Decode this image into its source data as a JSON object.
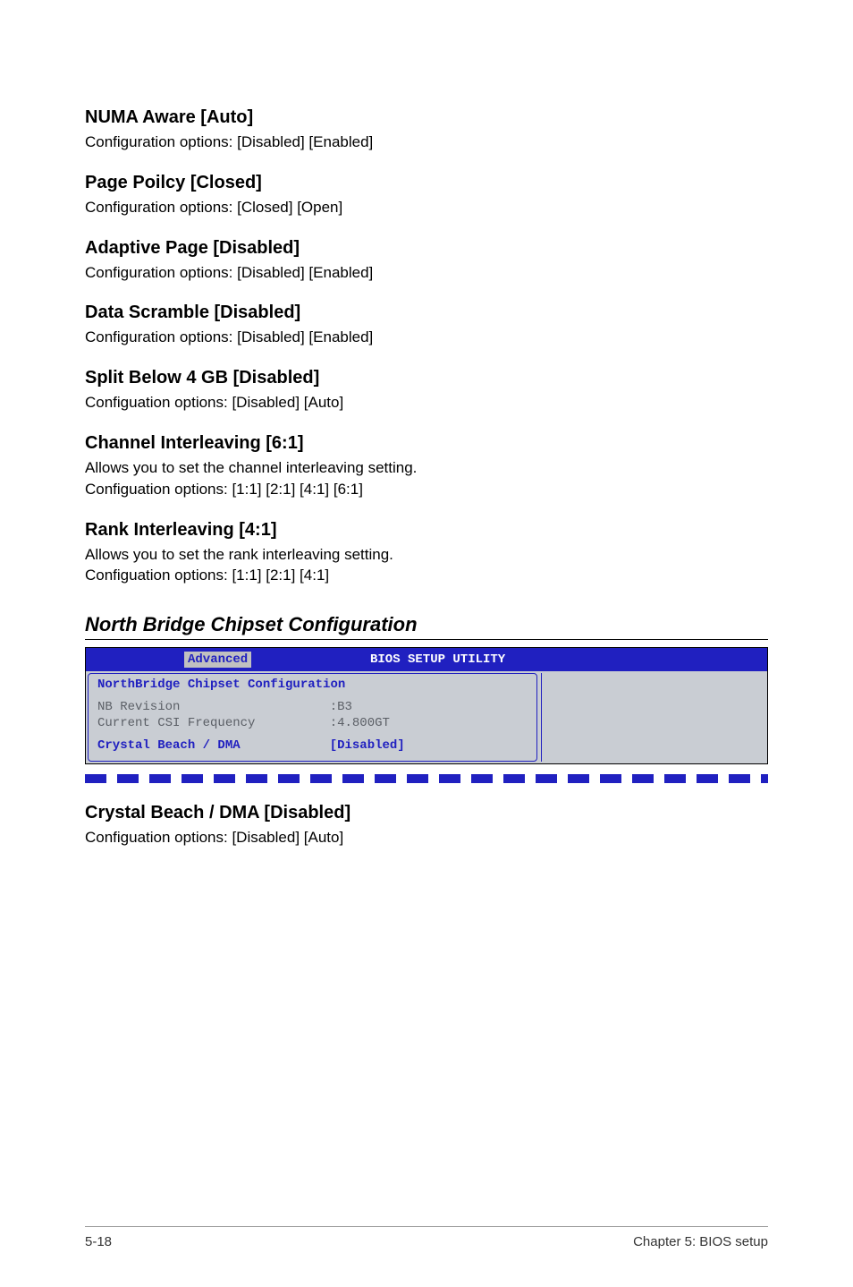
{
  "sections": {
    "numa": {
      "heading": "NUMA Aware [Auto]",
      "body": "Configuration options: [Disabled] [Enabled]"
    },
    "page_policy": {
      "heading": "Page Poilcy [Closed]",
      "body": "Configuration options: [Closed] [Open]"
    },
    "adaptive": {
      "heading": "Adaptive Page [Disabled]",
      "body": "Configuration options: [Disabled] [Enabled]"
    },
    "scramble": {
      "heading": "Data Scramble [Disabled]",
      "body": "Configuration options: [Disabled] [Enabled]"
    },
    "split": {
      "heading": "Split Below 4 GB [Disabled]",
      "body": "Configuation options: [Disabled] [Auto]"
    },
    "channel": {
      "heading": "Channel Interleaving [6:1]",
      "body1": "Allows you to set the channel interleaving setting.",
      "body2": "Configuation options: [1:1] [2:1] [4:1] [6:1]"
    },
    "rank": {
      "heading": "Rank Interleaving [4:1]",
      "body1": "Allows you to set the rank interleaving setting.",
      "body2": "Configuation options: [1:1] [2:1] [4:1]"
    },
    "north_bridge_heading": "North Bridge Chipset Configuration",
    "crystal": {
      "heading": "Crystal Beach / DMA [Disabled]",
      "body": "Configuation options: [Disabled] [Auto]"
    }
  },
  "bios": {
    "tab": "Advanced",
    "title": "BIOS SETUP UTILITY",
    "subtitle": "NorthBridge Chipset Configuration",
    "rows": {
      "nb_rev": {
        "label": "NB Revision",
        "value": ":B3"
      },
      "csi": {
        "label": "Current CSI Frequency",
        "value": ":4.800GT"
      },
      "crystal": {
        "label": "Crystal Beach / DMA",
        "value": "[Disabled]"
      }
    }
  },
  "footer": {
    "left": "5-18",
    "right": "Chapter 5: BIOS setup"
  }
}
